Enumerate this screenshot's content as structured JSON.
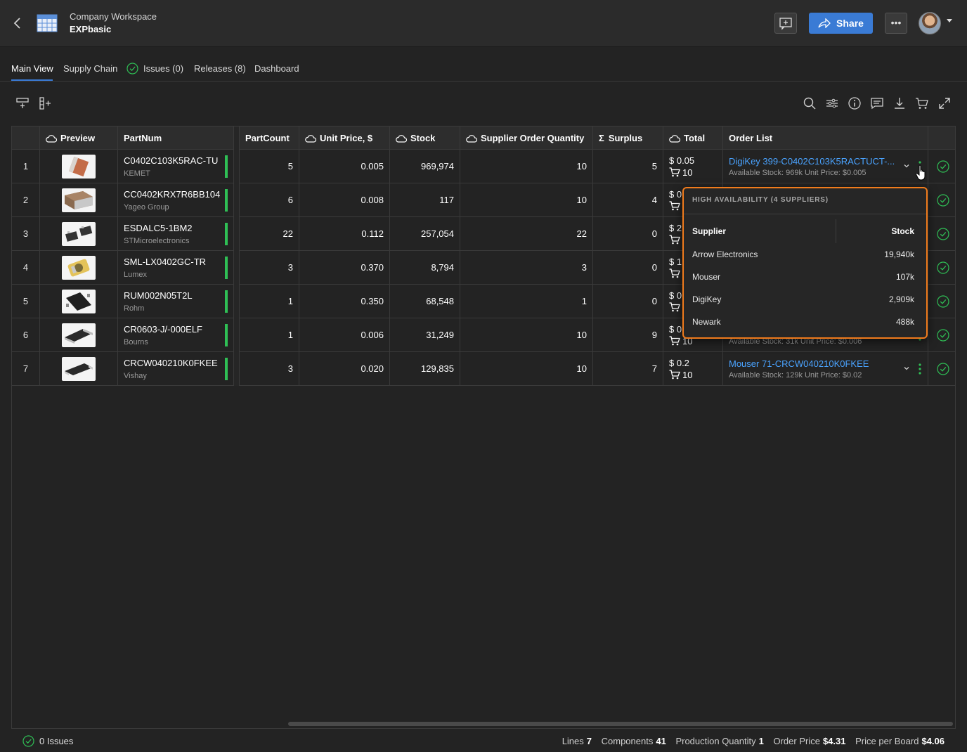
{
  "header": {
    "workspace_title": "Company Workspace",
    "project_name": "EXPbasic",
    "share_label": "Share"
  },
  "tabs": [
    {
      "label": "Main View",
      "active": true
    },
    {
      "label": "Supply Chain"
    },
    {
      "label": "Issues (0)"
    },
    {
      "label": "Releases (8)"
    },
    {
      "label": "Dashboard"
    }
  ],
  "columns": {
    "preview": "Preview",
    "partnum": "PartNum",
    "partcount": "PartCount",
    "unit_price": "Unit Price, $",
    "stock": "Stock",
    "soq": "Supplier Order Quantity",
    "surplus": "Surplus",
    "total": "Total",
    "order_list": "Order List"
  },
  "rows": [
    {
      "n": "1",
      "partnum": "C0402C103K5RAC-TU",
      "mfr": "KEMET",
      "count": "5",
      "price": "0.005",
      "stock": "969,974",
      "soq": "10",
      "surplus": "5",
      "total_price": "$ 0.05",
      "total_qty": "10",
      "order_link": "DigiKey 399-C0402C103K5RACTUCT-...",
      "order_sub": "Available Stock: 969k   Unit Price: $0.005"
    },
    {
      "n": "2",
      "partnum": "CC0402KRX7R6BB104",
      "mfr": "Yageo Group",
      "count": "6",
      "price": "0.008",
      "stock": "117",
      "soq": "10",
      "surplus": "4",
      "total_price": "$ 0",
      "total_qty": "",
      "order_link": "",
      "order_sub": ""
    },
    {
      "n": "3",
      "partnum": "ESDALC5-1BM2",
      "mfr": "STMicroelectronics",
      "count": "22",
      "price": "0.112",
      "stock": "257,054",
      "soq": "22",
      "surplus": "0",
      "total_price": "$ 2",
      "total_qty": "",
      "order_link": "",
      "order_sub": ""
    },
    {
      "n": "4",
      "partnum": "SML-LX0402GC-TR",
      "mfr": "Lumex",
      "count": "3",
      "price": "0.370",
      "stock": "8,794",
      "soq": "3",
      "surplus": "0",
      "total_price": "$ 1",
      "total_qty": "",
      "order_link": "",
      "order_sub": ""
    },
    {
      "n": "5",
      "partnum": "RUM002N05T2L",
      "mfr": "Rohm",
      "count": "1",
      "price": "0.350",
      "stock": "68,548",
      "soq": "1",
      "surplus": "0",
      "total_price": "$ 0",
      "total_qty": "",
      "order_link": "",
      "order_sub": ""
    },
    {
      "n": "6",
      "partnum": "CR0603-J/-000ELF",
      "mfr": "Bourns",
      "count": "1",
      "price": "0.006",
      "stock": "31,249",
      "soq": "10",
      "surplus": "9",
      "total_price": "$ 0",
      "total_qty": "10",
      "order_link": "",
      "order_sub": "Available Stock: 31k   Unit Price: $0.006"
    },
    {
      "n": "7",
      "partnum": "CRCW040210K0FKEE",
      "mfr": "Vishay",
      "count": "3",
      "price": "0.020",
      "stock": "129,835",
      "soq": "10",
      "surplus": "7",
      "total_price": "$ 0.2",
      "total_qty": "10",
      "order_link": "Mouser 71-CRCW040210K0FKEE",
      "order_sub": "Available Stock: 129k   Unit Price: $0.02"
    }
  ],
  "popover": {
    "title": "HIGH AVAILABILITY (4 SUPPLIERS)",
    "col_supplier": "Supplier",
    "col_stock": "Stock",
    "suppliers": [
      {
        "name": "Arrow Electronics",
        "stock": "19,940k"
      },
      {
        "name": "Mouser",
        "stock": "107k"
      },
      {
        "name": "DigiKey",
        "stock": "2,909k"
      },
      {
        "name": "Newark",
        "stock": "488k"
      }
    ]
  },
  "footer": {
    "issues": "0 Issues",
    "lines_label": "Lines",
    "lines": "7",
    "components_label": "Components",
    "components": "41",
    "prodqty_label": "Production Quantity",
    "prodqty": "1",
    "order_price_label": "Order Price",
    "order_price": "$4.31",
    "ppb_label": "Price per Board",
    "ppb": "$4.06"
  },
  "colors": {
    "accent": "#3a7bd5",
    "link": "#4aa3ff",
    "ok": "#2fbf55",
    "highlight": "#f07b1c"
  }
}
